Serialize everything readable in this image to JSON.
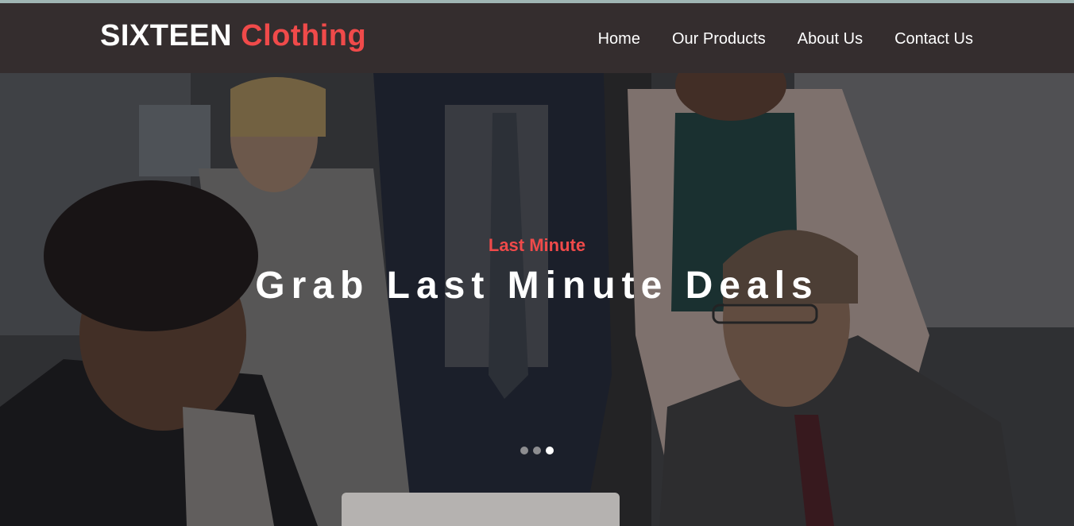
{
  "brand": {
    "name_primary": "SIXTEEN",
    "name_accent": "Clothing",
    "accent_color": "#f04a4a"
  },
  "nav": {
    "items": [
      {
        "label": "Home"
      },
      {
        "label": "Our Products"
      },
      {
        "label": "About Us"
      },
      {
        "label": "Contact Us"
      }
    ]
  },
  "hero": {
    "subtitle": "Last Minute",
    "title": "Grab Last Minute Deals",
    "slide_count": 3,
    "active_slide": 3
  },
  "colors": {
    "navbar_bg": "#342d2e",
    "accent": "#f04a4a",
    "text": "#ffffff"
  }
}
